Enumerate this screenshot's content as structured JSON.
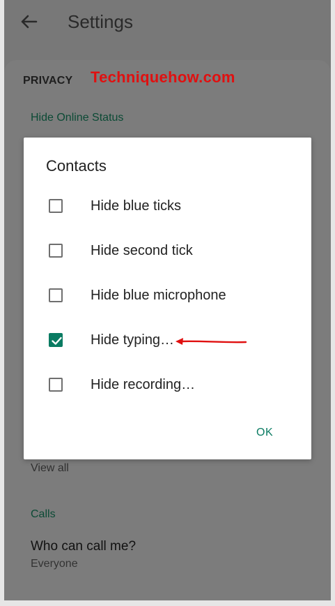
{
  "header": {
    "title": "Settings"
  },
  "section": {
    "privacy_label": "PRIVACY",
    "hide_online_status": "Hide Online Status"
  },
  "watermark": "Techniquehow.com",
  "dialog": {
    "title": "Contacts",
    "options": [
      {
        "label": "Hide blue ticks",
        "checked": false
      },
      {
        "label": "Hide second tick",
        "checked": false
      },
      {
        "label": "Hide blue microphone",
        "checked": false
      },
      {
        "label": "Hide typing…",
        "checked": true
      },
      {
        "label": "Hide recording…",
        "checked": false
      }
    ],
    "ok_label": "OK"
  },
  "background": {
    "view_all": "View all",
    "calls_header": "Calls",
    "call_item": {
      "title": "Who can call me?",
      "subtitle": "Everyone"
    }
  },
  "colors": {
    "accent": "#0a7b62",
    "arrow": "#e01010",
    "scrim": "#787878"
  }
}
